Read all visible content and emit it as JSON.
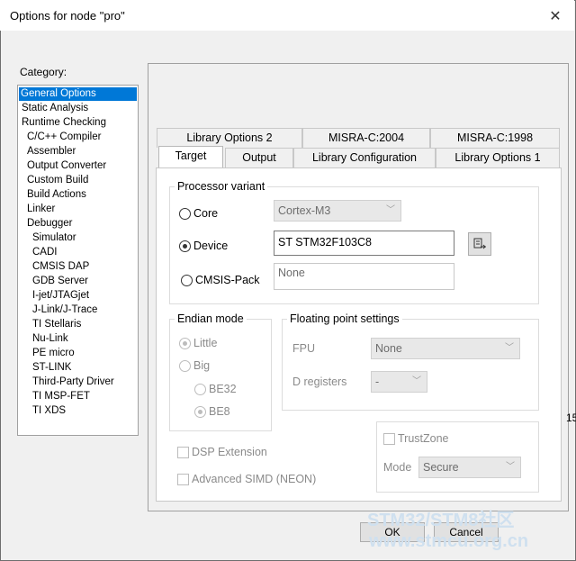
{
  "window": {
    "title": "Options for node \"pro\""
  },
  "category": {
    "label": "Category:",
    "items": [
      {
        "label": "General Options",
        "indent": 0,
        "selected": true
      },
      {
        "label": "Static Analysis",
        "indent": 0
      },
      {
        "label": "Runtime Checking",
        "indent": 0
      },
      {
        "label": "C/C++ Compiler",
        "indent": 1
      },
      {
        "label": "Assembler",
        "indent": 1
      },
      {
        "label": "Output Converter",
        "indent": 1
      },
      {
        "label": "Custom Build",
        "indent": 1
      },
      {
        "label": "Build Actions",
        "indent": 1
      },
      {
        "label": "Linker",
        "indent": 1
      },
      {
        "label": "Debugger",
        "indent": 1
      },
      {
        "label": "Simulator",
        "indent": 2
      },
      {
        "label": "CADI",
        "indent": 2
      },
      {
        "label": "CMSIS DAP",
        "indent": 2
      },
      {
        "label": "GDB Server",
        "indent": 2
      },
      {
        "label": "I-jet/JTAGjet",
        "indent": 2
      },
      {
        "label": "J-Link/J-Trace",
        "indent": 2
      },
      {
        "label": "TI Stellaris",
        "indent": 2
      },
      {
        "label": "Nu-Link",
        "indent": 2
      },
      {
        "label": "PE micro",
        "indent": 2
      },
      {
        "label": "ST-LINK",
        "indent": 2
      },
      {
        "label": "Third-Party Driver",
        "indent": 2
      },
      {
        "label": "TI MSP-FET",
        "indent": 2
      },
      {
        "label": "TI XDS",
        "indent": 2
      }
    ]
  },
  "tabs": {
    "row_back": [
      "Library Options 2",
      "MISRA-C:2004",
      "MISRA-C:1998"
    ],
    "row_front": [
      "Target",
      "Output",
      "Library Configuration",
      "Library Options 1"
    ],
    "active": "Target"
  },
  "processor": {
    "group_title": "Processor variant",
    "core_label": "Core",
    "core_value": "Cortex-M3",
    "device_label": "Device",
    "device_value": "ST STM32F103C8",
    "cmsis_label": "CMSIS-Pack",
    "cmsis_value": "None",
    "selected": "Device"
  },
  "endian": {
    "group_title": "Endian mode",
    "little_label": "Little",
    "big_label": "Big",
    "be32_label": "BE32",
    "be8_label": "BE8"
  },
  "fpu": {
    "group_title": "Floating point settings",
    "fpu_label": "FPU",
    "fpu_value": "None",
    "dreg_label": "D registers",
    "dreg_value": "-"
  },
  "extensions": {
    "dsp_label": "DSP Extension",
    "simd_label": "Advanced SIMD (NEON)"
  },
  "trustzone": {
    "label": "TrustZone",
    "mode_label": "Mode",
    "mode_value": "Secure"
  },
  "buttons": {
    "ok": "OK",
    "cancel": "Cancel"
  },
  "watermark": {
    "line1": "STM32/STM8社区",
    "line2": "www.stmcu.org.cn"
  },
  "edge_fragment": "15"
}
